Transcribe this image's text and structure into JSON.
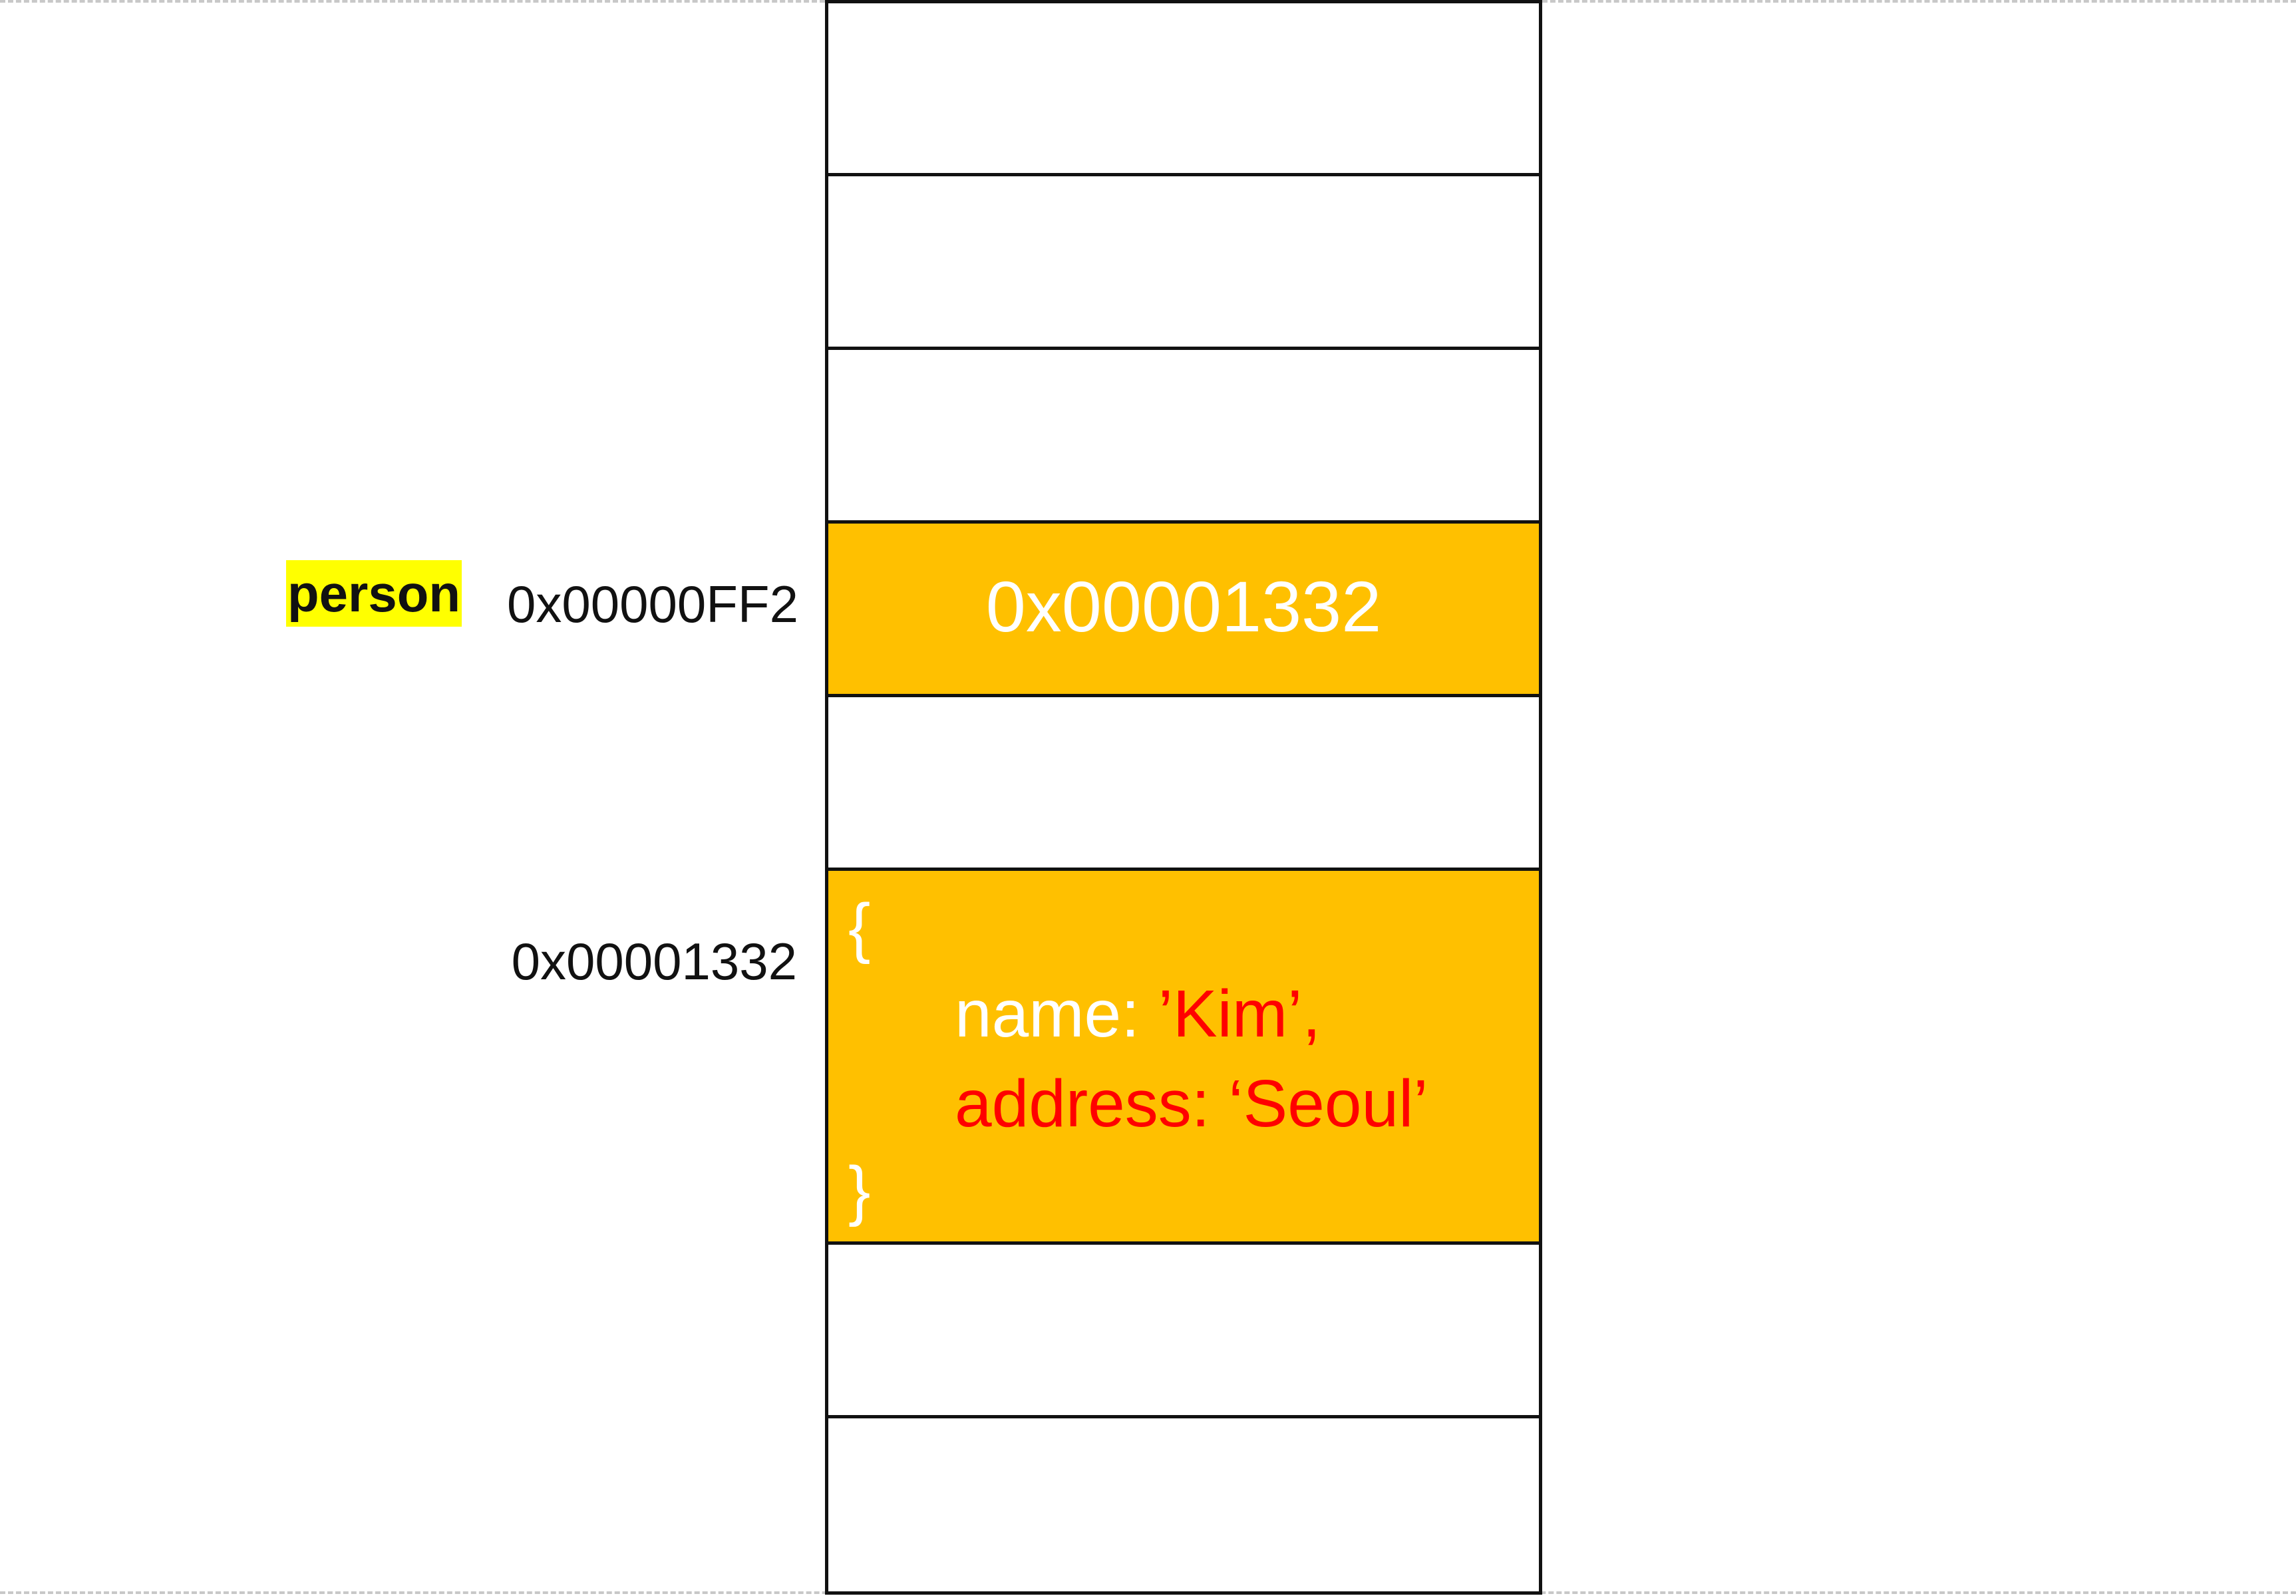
{
  "variable": {
    "name": "person",
    "address": "0x00000FF2",
    "value": "0x00001332"
  },
  "object": {
    "address": "0x00001332",
    "open_brace": "{",
    "close_brace": "}",
    "name_key": "name: ",
    "name_value": "’Kim’,",
    "address_key": "address: ",
    "address_value": "‘Seoul’"
  },
  "colors": {
    "cell_highlight": "#ffc000",
    "variable_highlight": "#ffff00",
    "string_value": "#ff0000",
    "cell_text": "#ffffff"
  },
  "memory": {
    "cell_count": 9,
    "variable_cell_index": 3,
    "object_cell_indices": [
      5,
      6
    ]
  }
}
